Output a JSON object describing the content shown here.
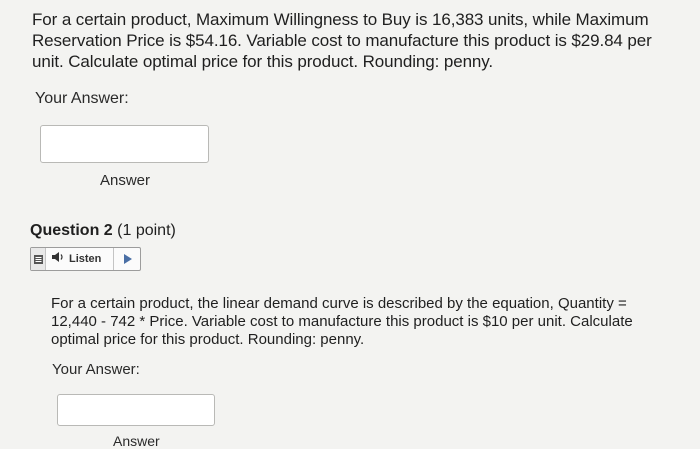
{
  "question1": {
    "text": "For a certain product, Maximum Willingness to Buy is 16,383 units, while Maximum Reservation Price is $54.16. Variable cost to manufacture this product is $29.84 per unit. Calculate optimal price for this product. Rounding: penny.",
    "your_answer_label": "Your Answer:",
    "answer_value": "",
    "answer_caption": "Answer"
  },
  "question2": {
    "title": "Question 2",
    "points": "(1 point)",
    "listen_label": "Listen",
    "text": "For a certain product, the linear demand curve is described by the equation, Quantity = 12,440 - 742 * Price. Variable cost to manufacture this product is $10 per unit. Calculate optimal price for this product. Rounding: penny.",
    "your_answer_label": "Your Answer:",
    "answer_value": "",
    "answer_caption": "Answer"
  },
  "icons": {
    "listen_menu": "menu-icon",
    "speaker": "speaker-icon",
    "play": "play-icon"
  },
  "colors": {
    "background": "#f3f3f1",
    "text": "#1f1f1f",
    "input_border": "#b9b9b6"
  }
}
